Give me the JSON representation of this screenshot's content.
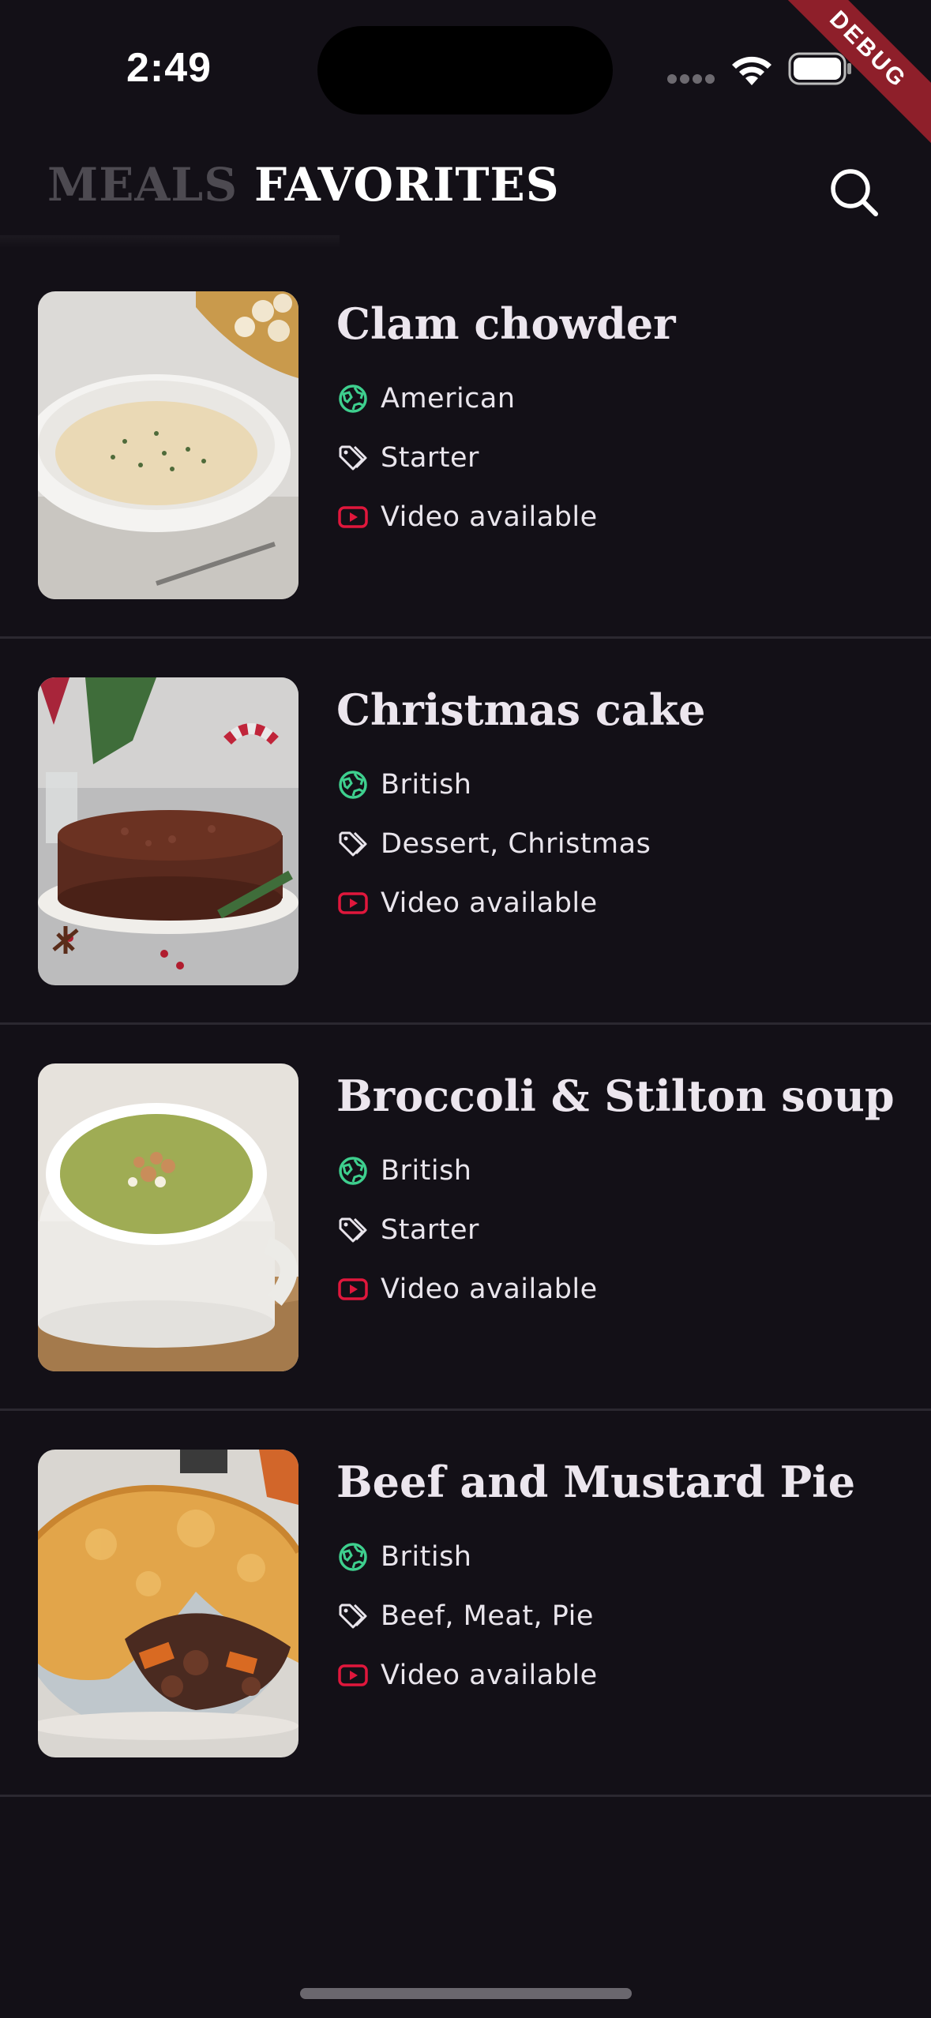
{
  "status_bar": {
    "time": "2:49",
    "debug_label": "DEBUG"
  },
  "header": {
    "tabs": [
      {
        "label": "MEALS",
        "selected": false
      },
      {
        "label": "FAVORITES",
        "selected": true
      }
    ],
    "search_icon": "search-icon"
  },
  "colors": {
    "background": "#131017",
    "area_icon": "#3ecf8e",
    "video_icon": "#e0173c",
    "inactive_tab": "#4d4a51"
  },
  "meals": [
    {
      "title": "Clam chowder",
      "area": "American",
      "tags": "Starter",
      "video": "Video available"
    },
    {
      "title": "Christmas cake",
      "area": "British",
      "tags": "Dessert, Christmas",
      "video": "Video available"
    },
    {
      "title": "Broccoli & Stilton soup",
      "area": "British",
      "tags": "Starter",
      "video": "Video available"
    },
    {
      "title": "Beef and Mustard Pie",
      "area": "British",
      "tags": "Beef, Meat, Pie",
      "video": "Video available"
    }
  ]
}
